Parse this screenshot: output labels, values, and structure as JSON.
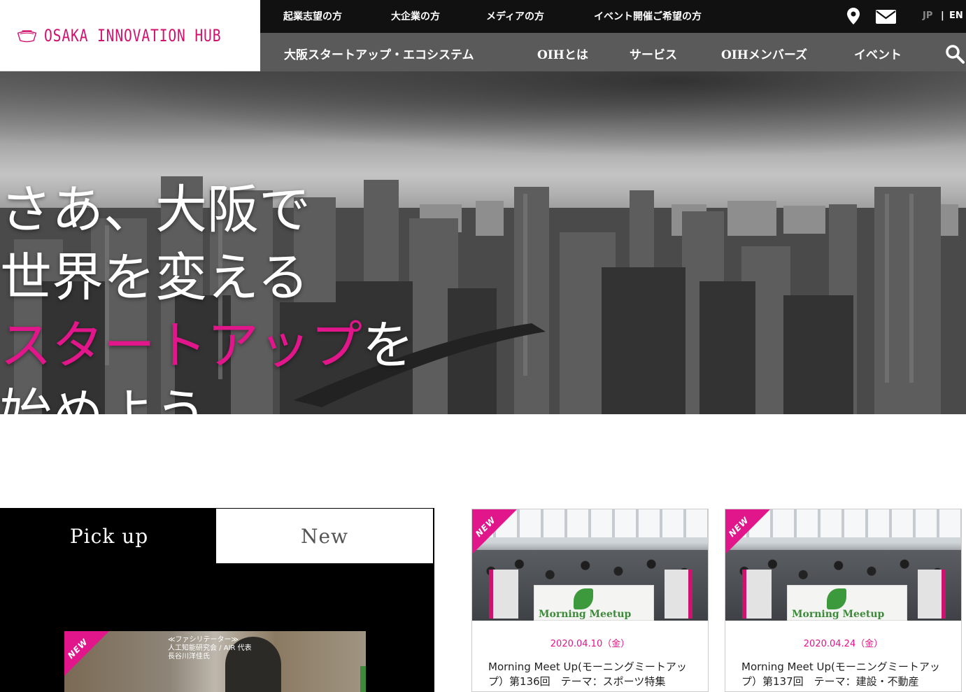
{
  "brand": {
    "name": "OSAKA INNOVATION HUB",
    "accent_color": "#e0168a",
    "logo_color": "#d0126f"
  },
  "topbar": {
    "links": [
      "起業志望の方",
      "大企業の方",
      "メディアの方",
      "イベント開催ご希望の方"
    ],
    "icons": [
      "location-pin-icon",
      "mail-icon"
    ],
    "lang": {
      "jp": "JP",
      "separator": "|",
      "en": "EN"
    }
  },
  "main_nav": {
    "items": [
      "大阪スタートアップ・エコシステム",
      "OIHとは",
      "サービス",
      "OIHメンバーズ",
      "イベント"
    ],
    "search_icon": "search-icon"
  },
  "hero": {
    "line1": "さあ、大阪で",
    "line2": "世界を変える",
    "line3_pink": "スタートアップ",
    "line3_tail": "を",
    "line4": "始めよう。"
  },
  "tabs": {
    "pickup": "Pick up",
    "new": "New"
  },
  "pickup_card": {
    "ribbon": "NEW",
    "caption_line1": "≪ファシリテーター≫",
    "caption_line2": "人工知能研究会 / AIR 代表",
    "caption_line3": "長谷川洋佳氏"
  },
  "event_cards": [
    {
      "ribbon": "NEW",
      "banner_text": "Morning Meetup",
      "date": "2020.04.10（金）",
      "title": "Morning Meet Up(モーニングミートアップ）第136回　テーマ：スポーツ特集"
    },
    {
      "ribbon": "NEW",
      "banner_text": "Morning Meetup",
      "date": "2020.04.24（金）",
      "title": "Morning Meet Up(モーニングミートアップ）第137回　テーマ：建設・不動産"
    }
  ]
}
